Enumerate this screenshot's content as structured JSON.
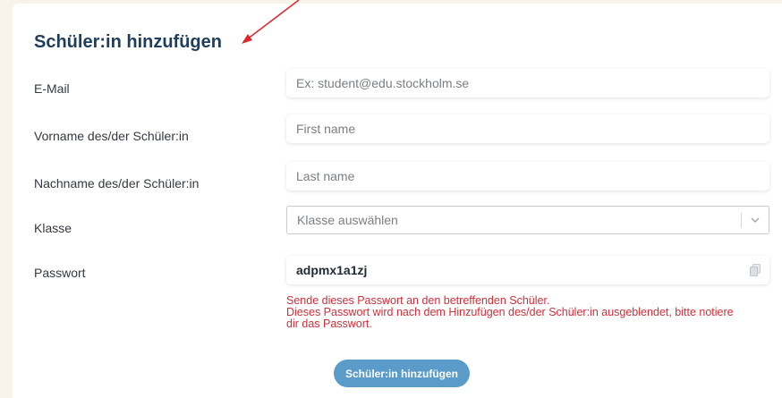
{
  "form": {
    "title": "Schüler:in hinzufügen",
    "fields": {
      "email": {
        "label": "E-Mail",
        "placeholder": "Ex: student@edu.stockholm.se"
      },
      "first_name": {
        "label": "Vorname des/der Schüler:in",
        "placeholder": "First name"
      },
      "last_name": {
        "label": "Nachname des/der Schüler:in",
        "placeholder": "Last name"
      },
      "class": {
        "label": "Klasse",
        "placeholder": "Klasse auswählen"
      },
      "password": {
        "label": "Passwort",
        "value": "adpmx1a1zj"
      }
    },
    "hint": {
      "line1": "Sende dieses Passwort an den betreffenden Schüler.",
      "line2": "Dieses Passwort wird nach dem Hinzufügen des/der Schüler:in ausgeblendet, bitte notiere dir das Passwort."
    },
    "submit_label": "Schüler:in hinzufügen"
  },
  "colors": {
    "page_background": "#f7f3ea",
    "title": "#1f3d5c",
    "hint": "#d02f3a",
    "button": "#5a9bc9",
    "annotation_arrow": "#e0262b"
  },
  "icons": {
    "copy": "copy-icon",
    "dropdown": "chevron-down-icon",
    "annotation": "arrow-annotation"
  }
}
